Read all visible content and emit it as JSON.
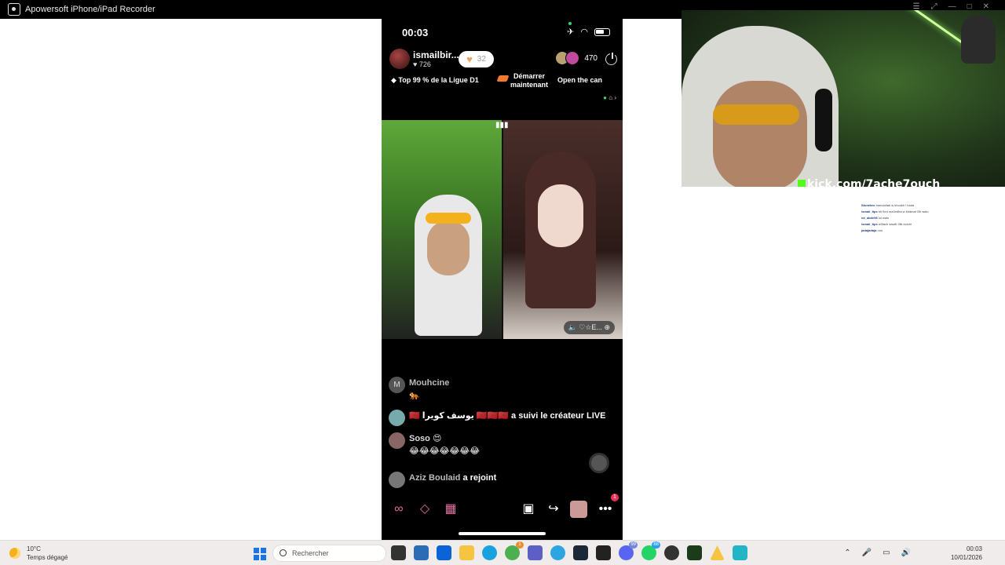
{
  "window": {
    "title": "Apowersoft iPhone/iPad Recorder"
  },
  "phone": {
    "status_time": "00:03",
    "host": {
      "name": "ismailbir...",
      "likes": "726",
      "follow_count": "32"
    },
    "viewer_count": "470",
    "rank_text": "Top 99 % de la Ligue D1",
    "start_text": "Démarrer maintenant",
    "open_text": "Open the can",
    "sound_tag": "♡☆E...",
    "comments": [
      {
        "avatar": "M",
        "name": "Mouhcine",
        "text": "🐅"
      },
      {
        "avatar": "",
        "name": "🇲🇦 يوسف كويرا 🇲🇦🇲🇦🇲🇦",
        "text": "a suivi le créateur LIVE"
      },
      {
        "avatar": "",
        "name": "Soso 😍",
        "text": "😂😂😂😂😂😂😂"
      },
      {
        "avatar": "",
        "name": "Aziz Boulaid",
        "text": "a rejoint"
      }
    ],
    "bottom": {
      "notification_count": "1"
    }
  },
  "webcam": {
    "stream_url": "kick.com/7ache7ouch"
  },
  "chat_overlay": [
    {
      "user": "Stonebro",
      "text": "hamdullah w khoukh l hada"
    },
    {
      "user": "ismail_tips",
      "text": "hh lbnt ma3ndha w khdmat l3b walo"
    },
    {
      "user": "ed_abde56",
      "text": "lol walo"
    },
    {
      "user": "ismail_tips",
      "text": "w3lach sawlti 3lik kolchi"
    },
    {
      "user": "jadajadaja",
      "text": "ooo"
    }
  ],
  "taskbar": {
    "temp": "10°C",
    "weather": "Temps dégagé",
    "search_placeholder": "Rechercher",
    "time": "00:03",
    "date": "10/01/2026",
    "badges": {
      "discord": "99",
      "whatsapp": "88",
      "chrome": "1"
    }
  }
}
